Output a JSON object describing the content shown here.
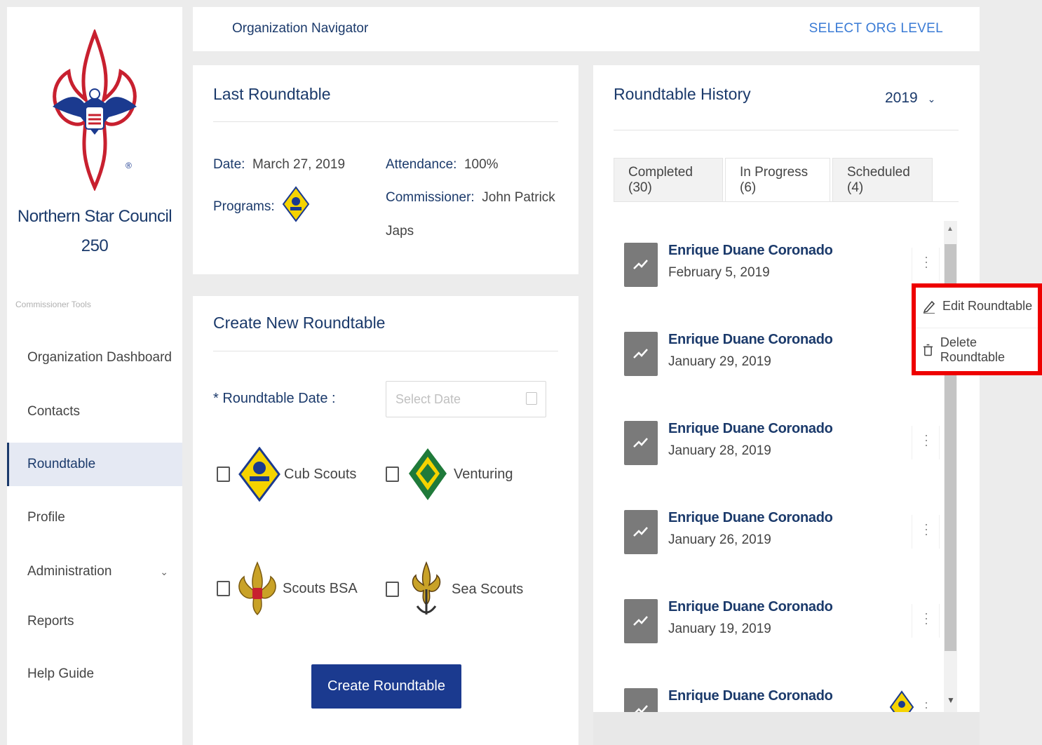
{
  "sidebar": {
    "council_name": "Northern Star Council",
    "council_number": "250",
    "tools_label": "Commissioner Tools",
    "items": [
      {
        "label": "Organization Dashboard"
      },
      {
        "label": "Contacts"
      },
      {
        "label": "Roundtable"
      },
      {
        "label": "Profile"
      },
      {
        "label": "Administration"
      },
      {
        "label": "Reports"
      },
      {
        "label": "Help Guide"
      }
    ],
    "active_item": "Roundtable",
    "icons": [
      "bsa-fleur-de-lis-logo",
      "chevron-down-icon"
    ]
  },
  "topbar": {
    "title": "Organization Navigator",
    "select_org": "SELECT ORG LEVEL"
  },
  "last_roundtable": {
    "title": "Last Roundtable",
    "date_label": "Date:",
    "date_value": "March 27, 2019",
    "programs_label": "Programs:",
    "attendance_label": "Attendance:",
    "attendance_value": "100%",
    "commissioner_label": "Commissioner:",
    "commissioner_value_line1": "John Patrick",
    "commissioner_value_line2": "Japs",
    "program_icons": [
      "cub-scouts-icon"
    ]
  },
  "create_roundtable": {
    "title": "Create New Roundtable",
    "date_label": "* Roundtable Date :",
    "date_placeholder": "Select Date",
    "programs": [
      {
        "label": "Cub Scouts",
        "icon": "cub-scouts-icon",
        "checked": false
      },
      {
        "label": "Venturing",
        "icon": "venturing-icon",
        "checked": false
      },
      {
        "label": "Scouts BSA",
        "icon": "scouts-bsa-icon",
        "checked": false
      },
      {
        "label": "Sea Scouts",
        "icon": "sea-scouts-icon",
        "checked": false
      }
    ],
    "button_label": "Create Roundtable"
  },
  "history": {
    "title": "Roundtable History",
    "year": "2019",
    "tabs": [
      {
        "label": "Completed (30)"
      },
      {
        "label": "In Progress (6)"
      },
      {
        "label": "Scheduled (4)"
      }
    ],
    "active_tab": "In Progress (6)",
    "items": [
      {
        "name": "Enrique Duane Coronado",
        "date": "February 5, 2019"
      },
      {
        "name": "Enrique Duane Coronado",
        "date": "January 29, 2019"
      },
      {
        "name": "Enrique Duane Coronado",
        "date": "January 28, 2019"
      },
      {
        "name": "Enrique Duane Coronado",
        "date": "January 26, 2019"
      },
      {
        "name": "Enrique Duane Coronado",
        "date": "January 19, 2019"
      },
      {
        "name": "Enrique Duane Coronado",
        "date": ""
      }
    ],
    "context_menu": [
      {
        "label": "Edit Roundtable",
        "icon": "pencil-icon"
      },
      {
        "label": "Delete Roundtable",
        "icon": "trash-icon"
      }
    ],
    "highlight_color": "#ee0000"
  },
  "colors": {
    "brand_navy": "#1b3a6b",
    "link_blue": "#3a7bd5",
    "button_blue": "#1b3a8f"
  }
}
